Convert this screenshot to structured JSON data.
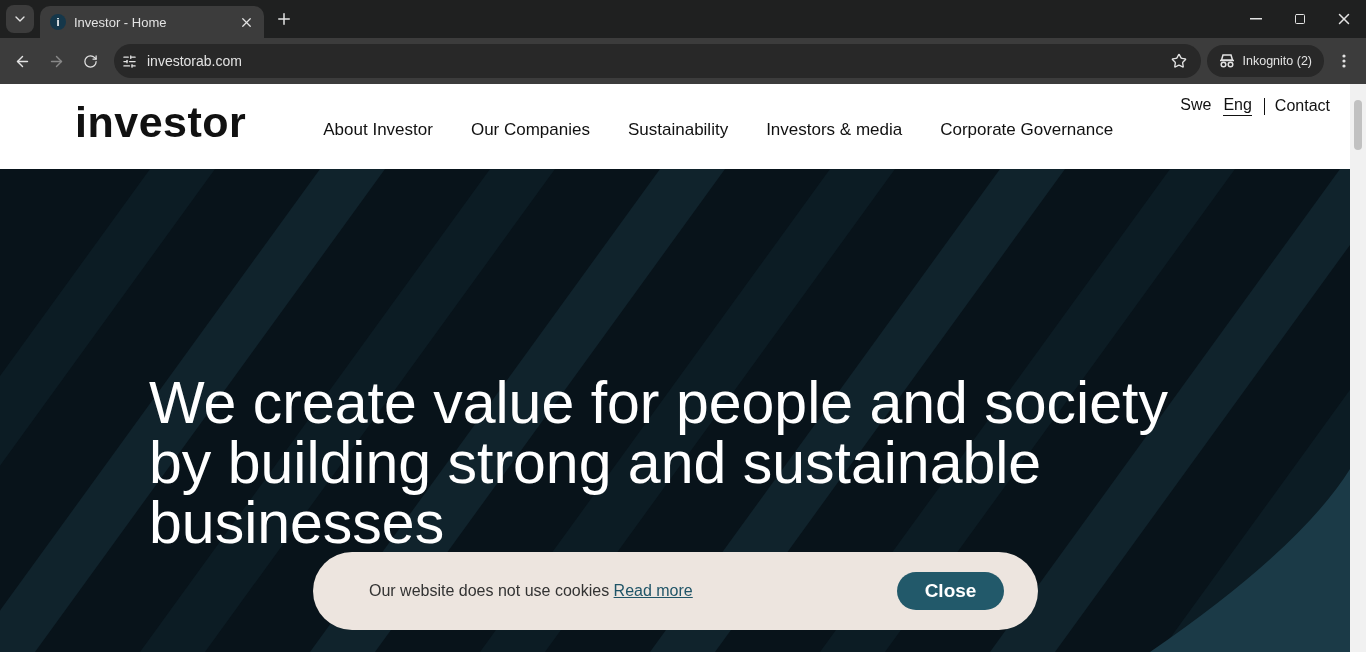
{
  "browser": {
    "tab": {
      "title": "Investor - Home",
      "favicon": "i"
    },
    "address": "investorab.com",
    "profile": "Inkognito (2)"
  },
  "header": {
    "logo": "investor",
    "nav": [
      "About Investor",
      "Our Companies",
      "Sustainability",
      "Investors & media",
      "Corporate Governance"
    ],
    "languages": [
      {
        "label": "Swe",
        "selected": false
      },
      {
        "label": "Eng",
        "selected": true
      }
    ],
    "contact": "Contact"
  },
  "hero": {
    "kind": "picture",
    "heading": "We create value for people and society by building strong and sustainable businesses"
  },
  "cookie_banner": {
    "text": "Our website does not use cookies",
    "link": "Read more",
    "button": "Close"
  }
}
